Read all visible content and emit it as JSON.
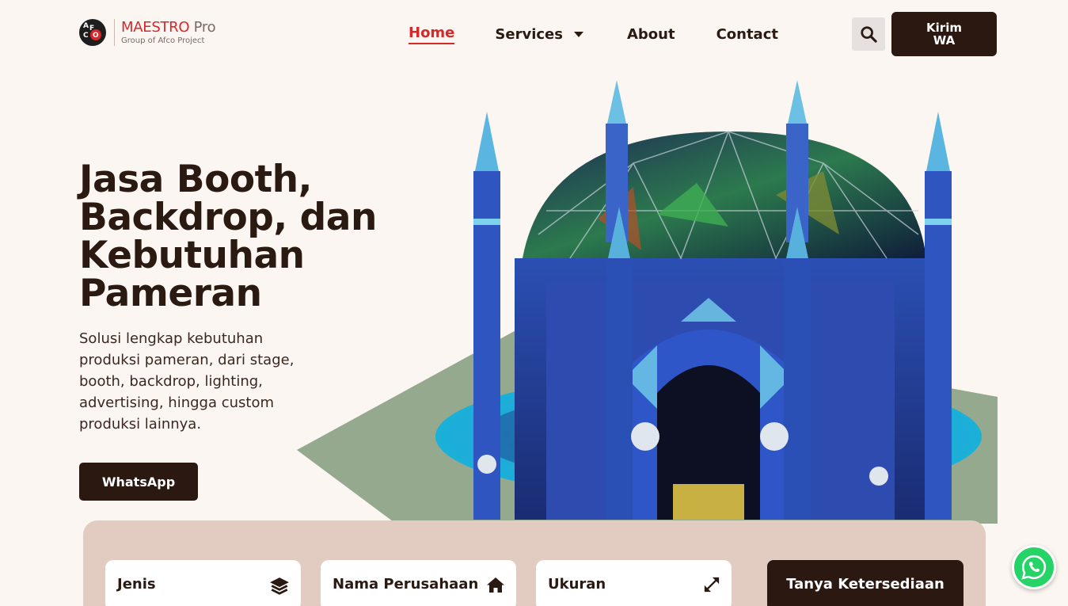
{
  "brand": {
    "logo_letters": [
      "A",
      "F",
      "C",
      "O"
    ],
    "name": "MAESTRO",
    "name_suffix": "Pro",
    "tagline": "Group of Afco Project",
    "accent_color": "#d62828"
  },
  "nav": {
    "items": [
      {
        "label": "Home",
        "active": true
      },
      {
        "label": "Services",
        "has_dropdown": true
      },
      {
        "label": "About"
      },
      {
        "label": "Contact"
      }
    ],
    "search_icon": "search-icon",
    "cta_label": "Kirim WA"
  },
  "hero": {
    "title": "Jasa Booth, Backdrop, dan Kebutuhan Pameran",
    "description": "Solusi lengkap kebutuhan produksi pameran, dari stage, booth, backdrop, lighting, advertising, hingga custom produksi lainnya.",
    "button_label": "WhatsApp",
    "image_subject": "mosque-booth-3d-render"
  },
  "form": {
    "fields": [
      {
        "label": "Jenis",
        "icon": "layers-icon"
      },
      {
        "label": "Nama Perusahaan",
        "icon": "home-icon"
      },
      {
        "label": "Ukuran",
        "icon": "expand-icon"
      }
    ],
    "submit_label": "Tanya Ketersediaan"
  },
  "floating": {
    "icon": "whatsapp-icon"
  },
  "colors": {
    "background": "#fbf6f1",
    "dark_brown": "#2b1811",
    "panel": "#e2cbc1",
    "whatsapp_green": "#25d366"
  }
}
